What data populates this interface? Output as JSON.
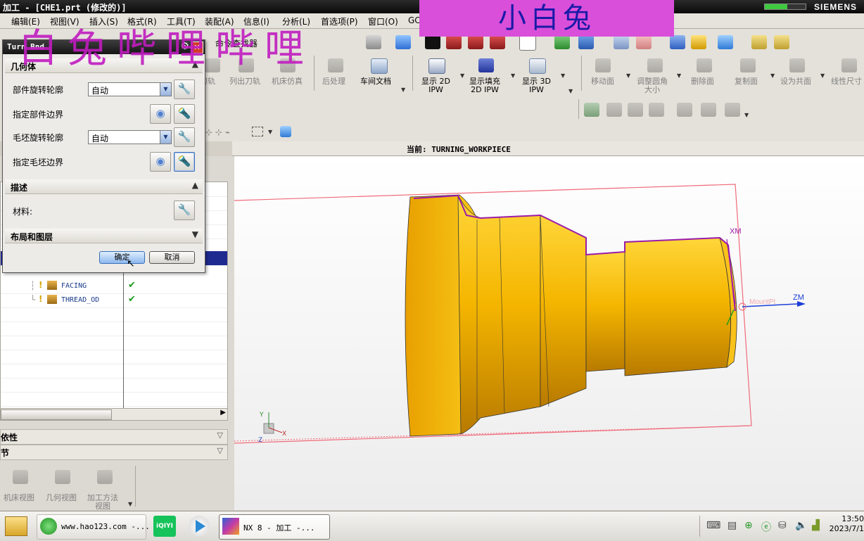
{
  "window": {
    "title": "加工 - [CHE1.prt (修改的)]",
    "brand": "SIEMENS",
    "progress": 0.55
  },
  "menu": [
    "编辑(E)",
    "视图(V)",
    "插入(S)",
    "格式(R)",
    "工具(T)",
    "装配(A)",
    "信息(I)",
    "分析(L)",
    "首选项(P)",
    "窗口(O)",
    "GC"
  ],
  "toolbar": {
    "command_finder": "命令查找器",
    "row1_labels": [
      {
        "text": "刀轨",
        "dark": false
      },
      {
        "text": "列出刀轨",
        "dark": false
      },
      {
        "text": "机床仿真",
        "dark": false
      },
      {
        "text": "后处理",
        "dark": false
      },
      {
        "text": "车间文档",
        "dark": true
      },
      {
        "text": "显示 2D\nIPW",
        "dark": true
      },
      {
        "text": "显示填充\n2D IPW",
        "dark": true
      },
      {
        "text": "显示 3D\nIPW",
        "dark": true
      },
      {
        "text": "移动面",
        "dark": false
      },
      {
        "text": "调整圆角\n大小",
        "dark": false
      },
      {
        "text": "删除面",
        "dark": false
      },
      {
        "text": "复制面",
        "dark": false
      },
      {
        "text": "设为共面",
        "dark": false
      },
      {
        "text": "线性尺寸",
        "dark": false
      }
    ]
  },
  "current": {
    "label": "当前: TURNING_WORKPIECE"
  },
  "viewport": {
    "axis_xm": "XM",
    "axis_zm": "ZM",
    "mount_label": "MountPt",
    "wcs_x": "X",
    "wcs_y": "Y",
    "wcs_z": "Z",
    "part_color": "#f2b400",
    "boundary_color": "#f05a6a"
  },
  "nav": {
    "operations": [
      {
        "name": "FACING",
        "status": "✔"
      },
      {
        "name": "THREAD_OD",
        "status": "✔"
      }
    ],
    "sections": [
      "依性",
      "节"
    ],
    "buttons": [
      "机床视图",
      "几何视图",
      "加工方法\n视图"
    ]
  },
  "dialog": {
    "title": "Turn Bnd",
    "section_geometry": "几何体",
    "part_rev_label": "部件旋转轮廓",
    "part_rev_value": "自动",
    "part_boundary_label": "指定部件边界",
    "blank_rev_label": "毛坯旋转轮廓",
    "blank_rev_value": "自动",
    "blank_boundary_label": "指定毛坯边界",
    "section_description": "描述",
    "material_label": "材料:",
    "section_layout": "布局和图层",
    "ok": "确定",
    "cancel": "取消"
  },
  "watermark": {
    "top": "小白兔",
    "left": "白兔哔哩哔哩"
  },
  "taskbar": {
    "items": [
      "www.hao123.com -...",
      "iQIYI",
      "NX 8 - 加工 -..."
    ],
    "time": "13:50",
    "date": "2023/7/1"
  }
}
